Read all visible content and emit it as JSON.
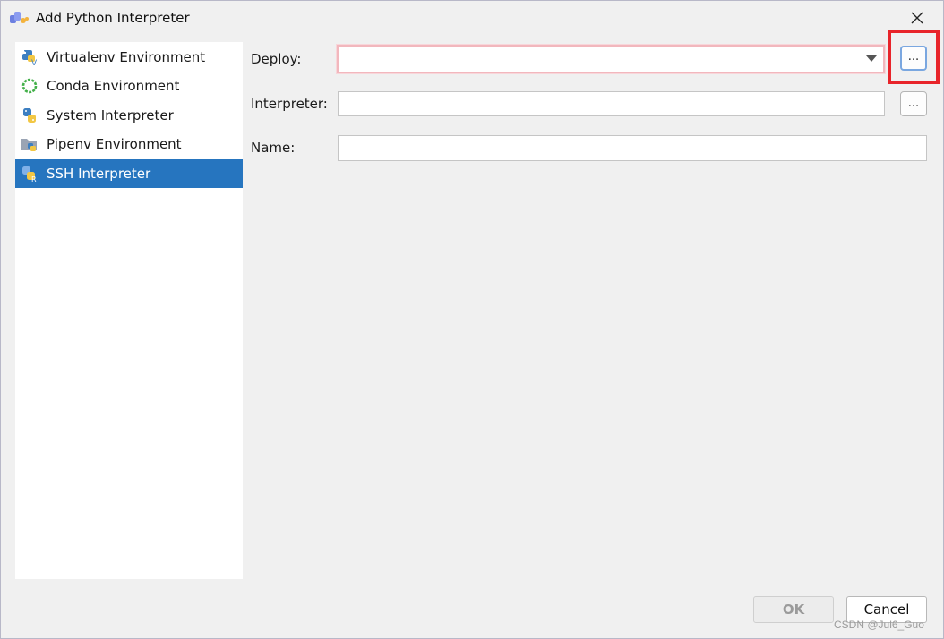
{
  "window": {
    "title": "Add Python Interpreter",
    "icon": "python-interpreter-icon",
    "close_icon": "close-icon"
  },
  "sidebar": {
    "items": [
      {
        "label": "Virtualenv Environment",
        "icon": "virtualenv-icon",
        "selected": false
      },
      {
        "label": "Conda Environment",
        "icon": "conda-icon",
        "selected": false
      },
      {
        "label": "System Interpreter",
        "icon": "python-icon",
        "selected": false
      },
      {
        "label": "Pipenv Environment",
        "icon": "pipenv-icon",
        "selected": false
      },
      {
        "label": "SSH Interpreter",
        "icon": "ssh-python-icon",
        "selected": true
      }
    ]
  },
  "form": {
    "deploy_label": "Deploy:",
    "deploy_value": "",
    "deploy_browse": "...",
    "interpreter_label": "Interpreter:",
    "interpreter_value": "",
    "interpreter_browse": "...",
    "name_label": "Name:",
    "name_value": ""
  },
  "footer": {
    "ok_label": "OK",
    "cancel_label": "Cancel"
  },
  "watermark": "CSDN @Jul6_Guo",
  "colors": {
    "selection": "#2675bf",
    "highlight": "#e8242a",
    "error_border": "#f2b7bd"
  }
}
